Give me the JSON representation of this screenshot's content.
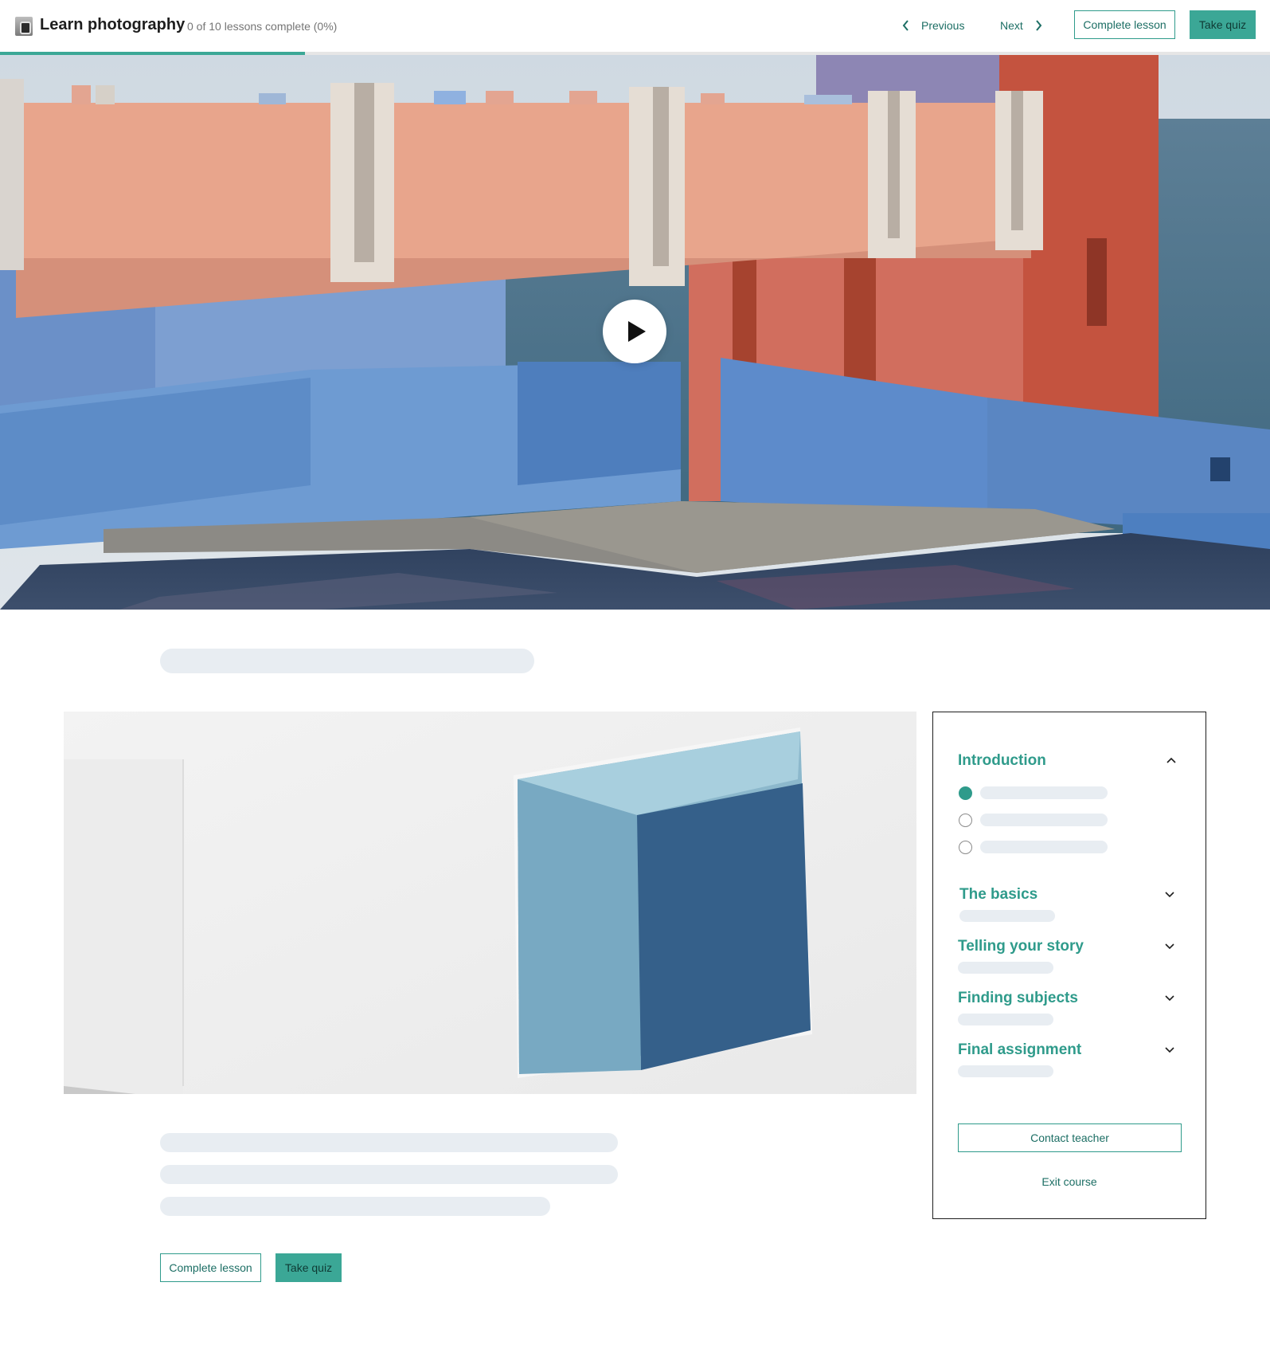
{
  "header": {
    "course_title": "Learn photography",
    "progress_text": "0 of 10 lessons complete (0%)",
    "progress_fraction": 0.24,
    "prev_label": "Previous",
    "next_label": "Next",
    "complete_label": "Complete lesson",
    "quiz_label": "Take quiz"
  },
  "hero": {
    "type": "video",
    "play_icon": "play-icon"
  },
  "content": {
    "complete_label": "Complete lesson",
    "quiz_label": "Take quiz"
  },
  "sidebar": {
    "sections": [
      {
        "title": "Introduction",
        "expanded": true
      },
      {
        "title": "The basics",
        "expanded": false
      },
      {
        "title": "Telling your story",
        "expanded": false
      },
      {
        "title": "Finding subjects",
        "expanded": false
      },
      {
        "title": "Final assignment",
        "expanded": false
      }
    ],
    "lessons": [
      {
        "state": "current"
      },
      {
        "state": "incomplete"
      },
      {
        "state": "incomplete"
      }
    ],
    "contact_label": "Contact teacher",
    "exit_label": "Exit course"
  },
  "colors": {
    "accent": "#3ba796",
    "accent_dark": "#1c6e64",
    "skeleton": "#e8edf2"
  }
}
